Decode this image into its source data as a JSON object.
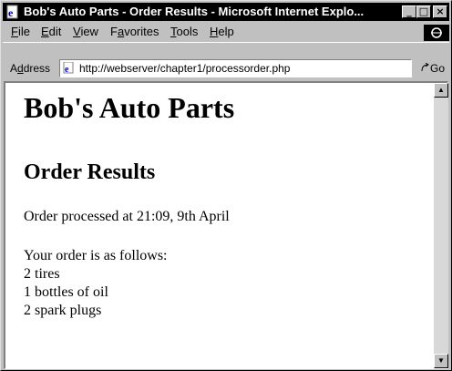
{
  "window": {
    "title": "Bob's Auto Parts - Order Results - Microsoft Internet Explo...",
    "minimize_glyph": "_",
    "maximize_glyph": "□",
    "close_glyph": "×"
  },
  "menu": {
    "items": [
      {
        "accel": "F",
        "rest": "ile"
      },
      {
        "accel": "E",
        "rest": "dit"
      },
      {
        "accel": "V",
        "rest": "iew"
      },
      {
        "pre": "F",
        "accel": "a",
        "rest": "vorites"
      },
      {
        "accel": "T",
        "rest": "ools"
      },
      {
        "accel": "H",
        "rest": "elp"
      }
    ]
  },
  "address": {
    "label_pre": "A",
    "label_accel": "d",
    "label_rest": "dress",
    "url": "http://webserver/chapter1/processorder.php",
    "dropdown_glyph": "▼",
    "go_label": "Go"
  },
  "page": {
    "heading": "Bob's Auto Parts",
    "subheading": "Order Results",
    "processed": "Order processed at 21:09, 9th April",
    "intro": "Your order is as follows:",
    "items": [
      "2 tires",
      "1 bottles of oil",
      "2 spark plugs"
    ]
  },
  "scrollbar": {
    "up_glyph": "▲",
    "down_glyph": "▼"
  },
  "icons": {
    "title_icon": "ie-page-icon",
    "address_icon": "ie-page-icon",
    "go_icon": "go-arrow-icon",
    "brand_icon": "ie-throbber-icon"
  }
}
